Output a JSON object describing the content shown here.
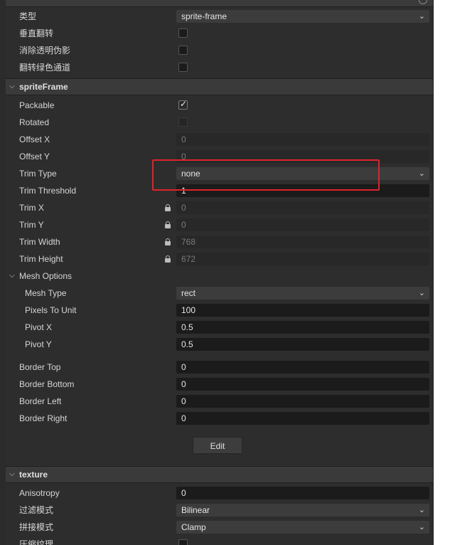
{
  "props": {
    "type_label": "类型",
    "type_value": "sprite-frame",
    "flip_v_label": "垂直翻转",
    "remove_alpha_label": "消除透明伪影",
    "flip_green_label": "翻转绿色通道"
  },
  "spriteFrame": {
    "title": "spriteFrame",
    "packable_label": "Packable",
    "packable_checked": true,
    "rotated_label": "Rotated",
    "offset_x_label": "Offset X",
    "offset_x": "0",
    "offset_y_label": "Offset Y",
    "offset_y": "0",
    "trim_type_label": "Trim Type",
    "trim_type": "none",
    "trim_threshold_label": "Trim Threshold",
    "trim_threshold": "1",
    "trim_x_label": "Trim X",
    "trim_x": "0",
    "trim_y_label": "Trim Y",
    "trim_y": "0",
    "trim_width_label": "Trim Width",
    "trim_width": "768",
    "trim_height_label": "Trim Height",
    "trim_height": "672",
    "mesh_options_label": "Mesh Options",
    "mesh_type_label": "Mesh Type",
    "mesh_type": "rect",
    "pixels_to_unit_label": "Pixels To Unit",
    "pixels_to_unit": "100",
    "pivot_x_label": "Pivot X",
    "pivot_x": "0.5",
    "pivot_y_label": "Pivot Y",
    "pivot_y": "0.5",
    "border_top_label": "Border Top",
    "border_top": "0",
    "border_bottom_label": "Border Bottom",
    "border_bottom": "0",
    "border_left_label": "Border Left",
    "border_left": "0",
    "border_right_label": "Border Right",
    "border_right": "0",
    "edit_button": "Edit"
  },
  "texture": {
    "title": "texture",
    "anisotropy_label": "Anisotropy",
    "anisotropy": "0",
    "filter_label": "过滤模式",
    "filter": "Bilinear",
    "wrap_label": "拼接模式",
    "wrap": "Clamp",
    "compress_label": "压缩纹理"
  },
  "icons": {
    "collapse": "chevron-down-icon",
    "lock": "lock-icon",
    "check": "check-icon"
  },
  "colors": {
    "highlight": "#e0222a",
    "panel_bg": "#2d2d2d"
  }
}
